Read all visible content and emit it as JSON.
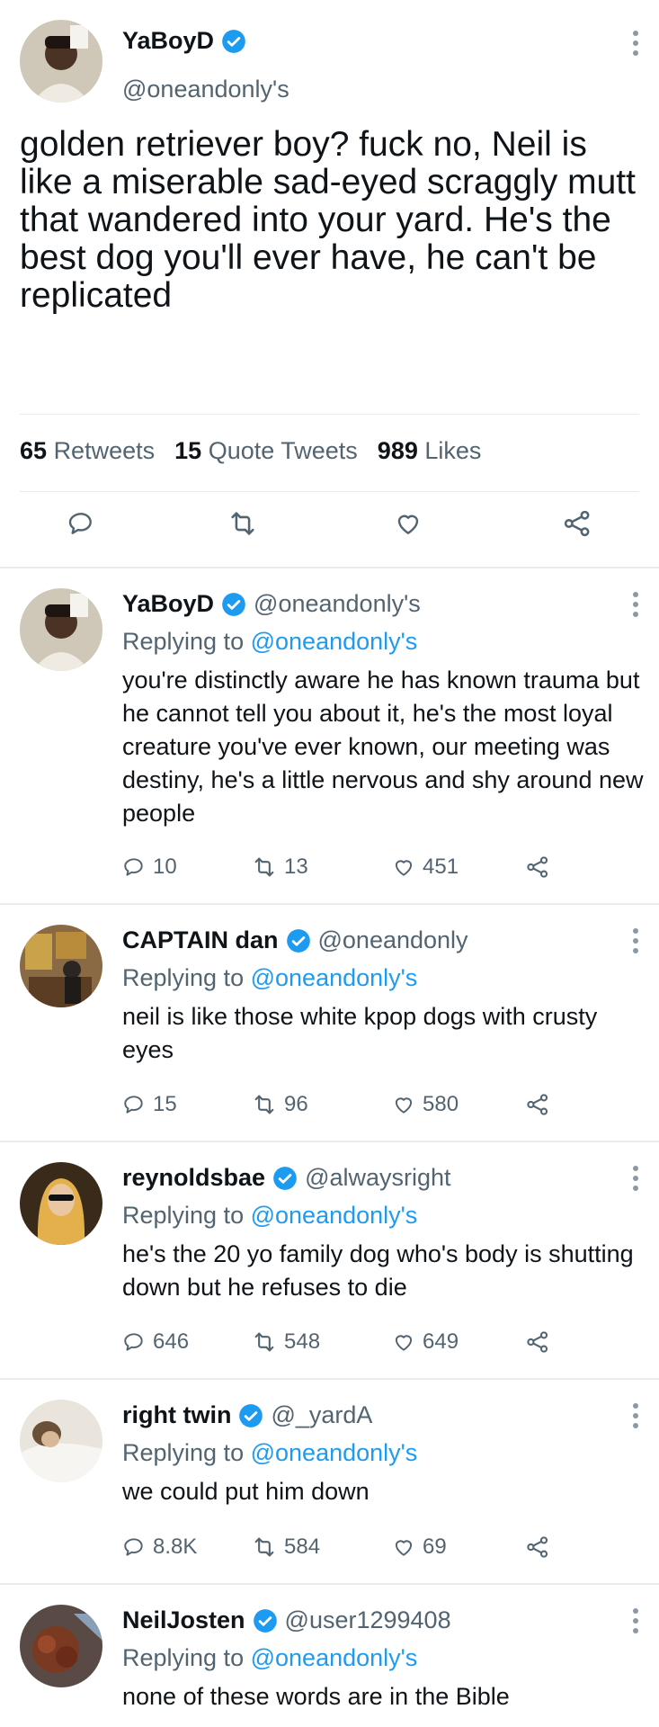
{
  "main_tweet": {
    "display_name": "YaBoyD",
    "handle": "@oneandonly's",
    "text": "golden retriever boy? fuck no, Neil is like a miserable sad-eyed scraggly mutt that wandered into your yard. He's the best dog you'll ever have, he can't be replicated",
    "retweets_count": "65",
    "retweets_label": "Retweets",
    "quotes_count": "15",
    "quotes_label": "Quote Tweets",
    "likes_count": "989",
    "likes_label": "Likes"
  },
  "replies": [
    {
      "display_name": "YaBoyD",
      "handle": "@oneandonly's",
      "replying_prefix": "Replying to",
      "replying_to": "@oneandonly's",
      "text": "you're distinctly aware he has known trauma but he cannot tell you about it, he's the most loyal creature you've ever known, our meeting was destiny, he's a little nervous and shy around new people",
      "replies": "10",
      "retweets": "13",
      "likes": "451"
    },
    {
      "display_name": "CAPTAIN dan",
      "handle": "@oneandonly",
      "replying_prefix": "Replying to",
      "replying_to": "@oneandonly's",
      "text": "neil is like those white kpop dogs with crusty eyes",
      "replies": "15",
      "retweets": "96",
      "likes": "580"
    },
    {
      "display_name": "reynoldsbae",
      "handle": "@alwaysright",
      "replying_prefix": "Replying to",
      "replying_to": "@oneandonly's",
      "text": "he's the 20 yo family dog who's body is shutting down but he refuses to die",
      "replies": "646",
      "retweets": "548",
      "likes": "649"
    },
    {
      "display_name": "right twin",
      "handle": "@_yardA",
      "replying_prefix": "Replying to",
      "replying_to": "@oneandonly's",
      "text": "we could put him down",
      "replies": "8.8K",
      "retweets": "584",
      "likes": "69"
    },
    {
      "display_name": "NeilJosten",
      "handle": "@user1299408",
      "replying_prefix": "Replying to",
      "replying_to": "@oneandonly's",
      "text": "none of these words are in the Bible"
    }
  ],
  "icons": {
    "verified": "verified-badge-icon",
    "reply": "reply-icon",
    "retweet": "retweet-icon",
    "like": "heart-icon",
    "share": "share-icon",
    "more": "more-icon"
  },
  "colors": {
    "verified": "#1d9bf0",
    "link": "#1d9bf0",
    "secondary": "#536471"
  }
}
